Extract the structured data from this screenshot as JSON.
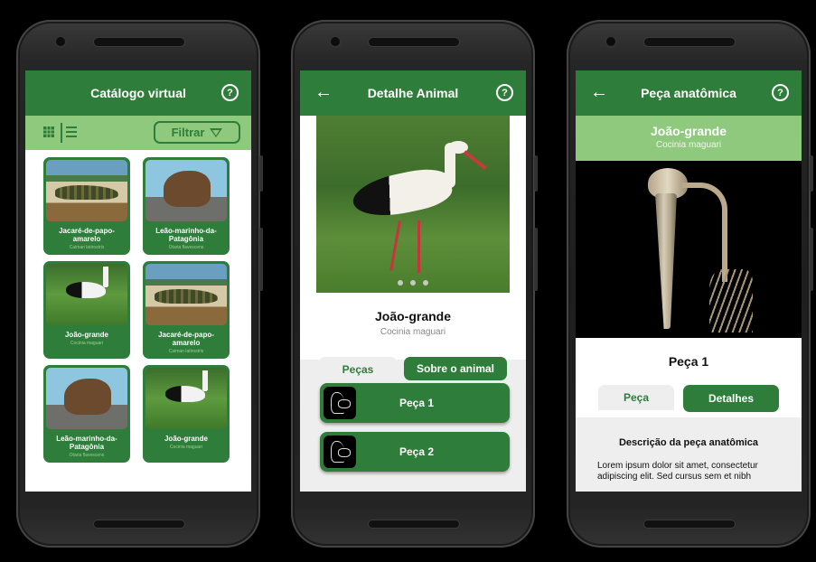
{
  "screen1": {
    "title": "Catálogo virtual",
    "help": "?",
    "filter_label": "Filtrar",
    "cards": [
      {
        "name": "Jacaré-de-papo-amarelo",
        "sci": "Caiman latirostris",
        "img": "jacare"
      },
      {
        "name": "Leão-marinho-da-Patagônia",
        "sci": "Otaria flavescens",
        "img": "leao"
      },
      {
        "name": "João-grande",
        "sci": "Cocinia maguari",
        "img": "joao"
      },
      {
        "name": "Jacaré-de-papo-amarelo",
        "sci": "Caiman latirostris",
        "img": "jacare"
      },
      {
        "name": "Leão-marinho-da-Patagônia",
        "sci": "Otaria flavescens",
        "img": "leao"
      },
      {
        "name": "João-grande",
        "sci": "Cocinia maguari",
        "img": "joao"
      }
    ]
  },
  "screen2": {
    "back": "←",
    "title": "Detalhe Animal",
    "help": "?",
    "animal_name": "João-grande",
    "animal_sci": "Cocinia maguari",
    "tab_pecas": "Peças",
    "tab_sobre": "Sobre o animal",
    "pieces": [
      "Peça 1",
      "Peça 2"
    ]
  },
  "screen3": {
    "back": "←",
    "title": "Peça anatômica",
    "help": "?",
    "animal_name": "João-grande",
    "animal_sci": "Cocinia maguari",
    "piece_title": "Peça 1",
    "tab_peca": "Peça",
    "tab_detalhes": "Detalhes",
    "desc_title": "Descrição da peça anatômica",
    "desc_text": "Lorem ipsum dolor sit amet, consectetur adipiscing elit. Sed cursus sem et nibh"
  },
  "colors": {
    "primary": "#2e7d3a",
    "light": "#8fc97e",
    "panel": "#eeeeee"
  },
  "icons": [
    "help-icon",
    "back-arrow-icon",
    "grid-view-icon",
    "list-view-icon",
    "filter-icon"
  ]
}
